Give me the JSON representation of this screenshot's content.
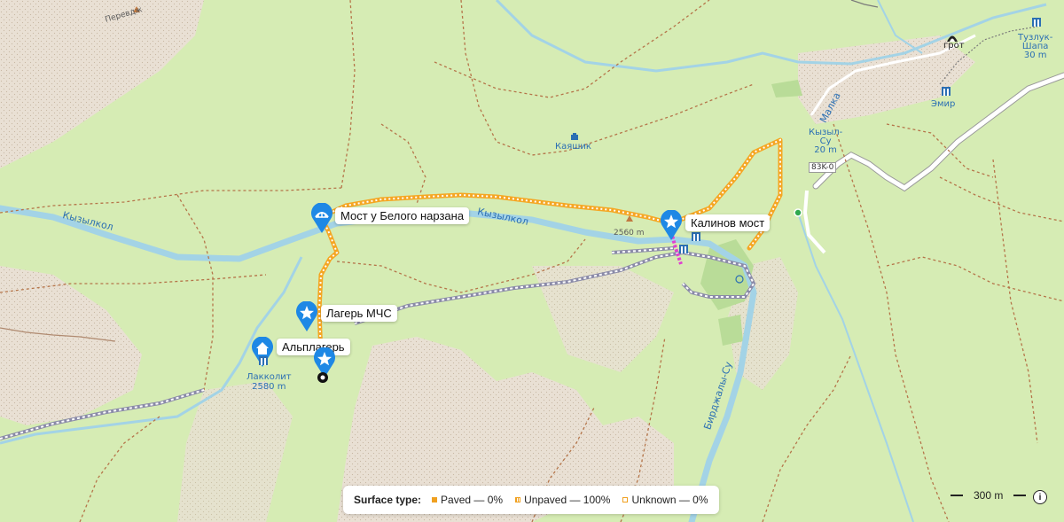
{
  "map": {
    "places": {
      "perevodzh": "Перевдж",
      "kayashik": "Каяшик",
      "grot": "грот",
      "tuzluk": "Тузлук-\nШапа\n30 m",
      "emir": "Эмир",
      "kyzyl_su": "Кызыл-\nСу\n20 m",
      "road_ref": "83K-0",
      "peak_2560": "2560 m",
      "lakkolit": "Лакколит\n2580 m",
      "river_kyzylkol": "Кызылкол",
      "river_kyzylkol2": "Кызылкол",
      "river_birdzhaly": "Бирджалы-Су",
      "river_malka": "Малка"
    }
  },
  "waypoints": [
    {
      "label": "Мост у Белого нарзана",
      "icon": "bridge-icon"
    },
    {
      "label": "Калинов мост",
      "icon": "star-icon"
    },
    {
      "label": "Лагерь МЧС",
      "icon": "star-icon"
    },
    {
      "label": "Альплагерь",
      "icon": "star-icon"
    },
    {
      "label": "",
      "icon": "home-icon"
    }
  ],
  "legend": {
    "title": "Surface type:",
    "items": [
      {
        "label": "Paved — 0%",
        "color": "#f0a020",
        "style": "filled"
      },
      {
        "label": "Unpaved — 100%",
        "color": "#f0a020",
        "style": "striped"
      },
      {
        "label": "Unknown — 0%",
        "color": "#f0a020",
        "style": "outline"
      }
    ]
  },
  "scale": {
    "label": "300 m"
  },
  "info": {
    "label": "i"
  },
  "colors": {
    "route": "#f5a623",
    "route_alt": "#e040d0",
    "water": "#a3d3e6",
    "road": "#ffffff",
    "pin": "#1e88e5",
    "track": "#8a8aa8"
  }
}
